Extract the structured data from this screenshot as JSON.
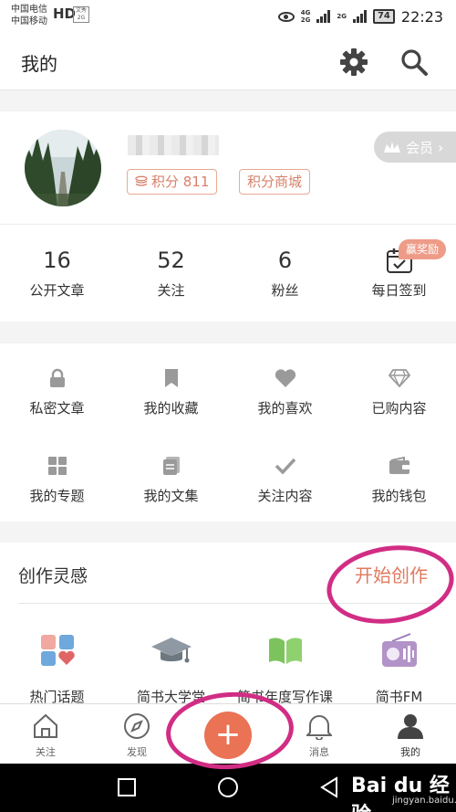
{
  "status_bar": {
    "carrier_1": "中国电信",
    "carrier_2": "中国移动",
    "hd_label": "HD",
    "badge_text": "文秀 2G",
    "net_1": "4G",
    "net_2": "2G",
    "net_3": "2G",
    "battery": "74",
    "time": "22:23"
  },
  "header": {
    "title": "我的"
  },
  "profile": {
    "points_label": "积分 811",
    "mall_label": "积分商城",
    "vip_label": "会员"
  },
  "stats": [
    {
      "num": "16",
      "label": "公开文章"
    },
    {
      "num": "52",
      "label": "关注"
    },
    {
      "num": "6",
      "label": "粉丝"
    },
    {
      "label": "每日签到"
    }
  ],
  "reward_badge": "赢奖励",
  "grid": [
    {
      "icon": "lock-icon",
      "label": "私密文章"
    },
    {
      "icon": "bookmark-icon",
      "label": "我的收藏"
    },
    {
      "icon": "heart-icon",
      "label": "我的喜欢"
    },
    {
      "icon": "diamond-icon",
      "label": "已购内容"
    },
    {
      "icon": "apps-icon",
      "label": "我的专题"
    },
    {
      "icon": "document-icon",
      "label": "我的文集"
    },
    {
      "icon": "check-icon",
      "label": "关注内容"
    },
    {
      "icon": "wallet-icon",
      "label": "我的钱包"
    }
  ],
  "inspiration": {
    "title": "创作灵感",
    "action": "开始创作",
    "items": [
      {
        "icon": "topics-icon",
        "label": "热门话题"
      },
      {
        "icon": "graduation-cap-icon",
        "label": "简书大学堂"
      },
      {
        "icon": "book-icon",
        "label": "简书年度写作课"
      },
      {
        "icon": "radio-icon",
        "label": "简书FM"
      }
    ]
  },
  "tabbar": [
    {
      "icon": "home-icon",
      "label": "关注"
    },
    {
      "icon": "compass-icon",
      "label": "发现"
    },
    {
      "icon": "bell-icon",
      "label": "消息"
    },
    {
      "icon": "user-icon",
      "label": "我的"
    }
  ],
  "fab_label": "+",
  "watermark": {
    "main": "Bai du 经验",
    "sub": "jingyan.baidu.com"
  }
}
